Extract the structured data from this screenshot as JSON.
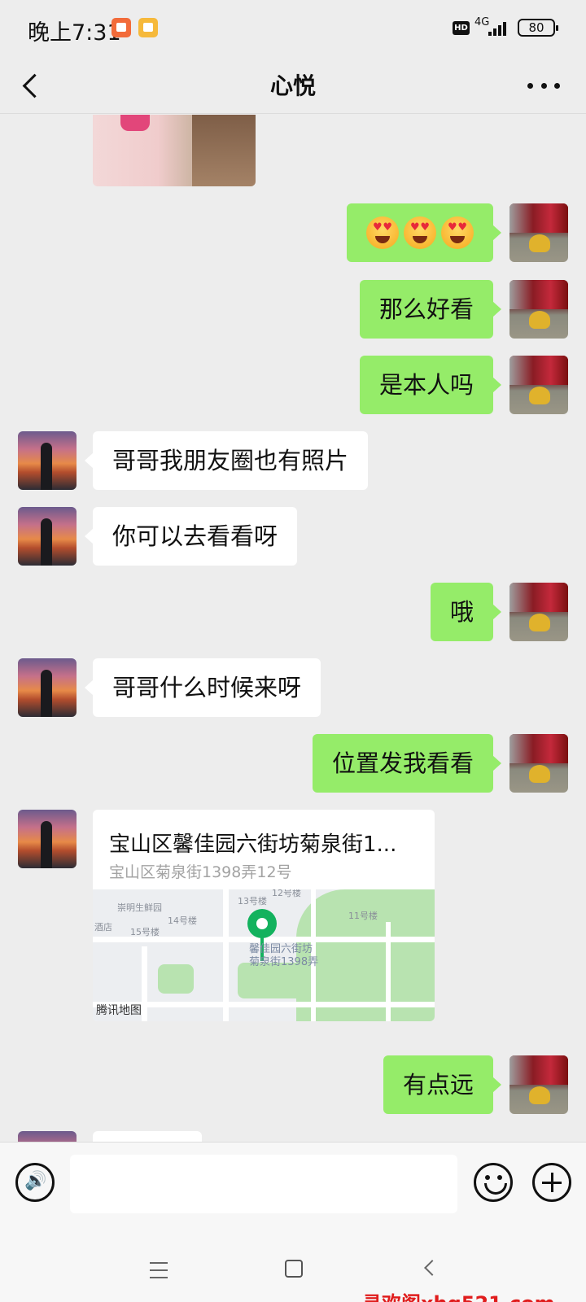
{
  "status_bar": {
    "time": "晚上7:31",
    "hd": "HD",
    "network": "4G",
    "battery": "80"
  },
  "header": {
    "title": "心悦"
  },
  "messages": [
    {
      "from": "her",
      "type": "photo"
    },
    {
      "from": "me",
      "type": "emoji",
      "emoji": [
        "smiling-face-with-heart-eyes",
        "smiling-face-with-heart-eyes",
        "smiling-face-with-heart-eyes"
      ]
    },
    {
      "from": "me",
      "type": "text",
      "text": "那么好看"
    },
    {
      "from": "me",
      "type": "text",
      "text": "是本人吗"
    },
    {
      "from": "her",
      "type": "text",
      "text": "哥哥我朋友圈也有照片"
    },
    {
      "from": "her",
      "type": "text",
      "text": "你可以去看看呀"
    },
    {
      "from": "me",
      "type": "text",
      "text": "哦"
    },
    {
      "from": "her",
      "type": "text",
      "text": "哥哥什么时候来呀"
    },
    {
      "from": "me",
      "type": "text",
      "text": "位置发我看看"
    },
    {
      "from": "her",
      "type": "location",
      "title": "宝山区馨佳园六街坊菊泉街1...",
      "address": "宝山区菊泉街1398弄12号"
    },
    {
      "from": "me",
      "type": "text",
      "text": "有点远"
    }
  ],
  "map": {
    "labels": [
      "崇明生鲜园",
      "酒店",
      "15号楼",
      "14号楼",
      "13号楼",
      "12号楼",
      "11号楼"
    ],
    "pin_label_1": "馨佳园六街坊",
    "pin_label_2": "菊泉街1398弄",
    "provider": "腾讯地图"
  },
  "input": {
    "placeholder": ""
  },
  "watermark": "寻欢阁xhg521.com",
  "colors": {
    "my_bubble": "#95ec69",
    "her_bubble": "#ffffff",
    "background": "#ededed",
    "pin": "#13b25e"
  }
}
